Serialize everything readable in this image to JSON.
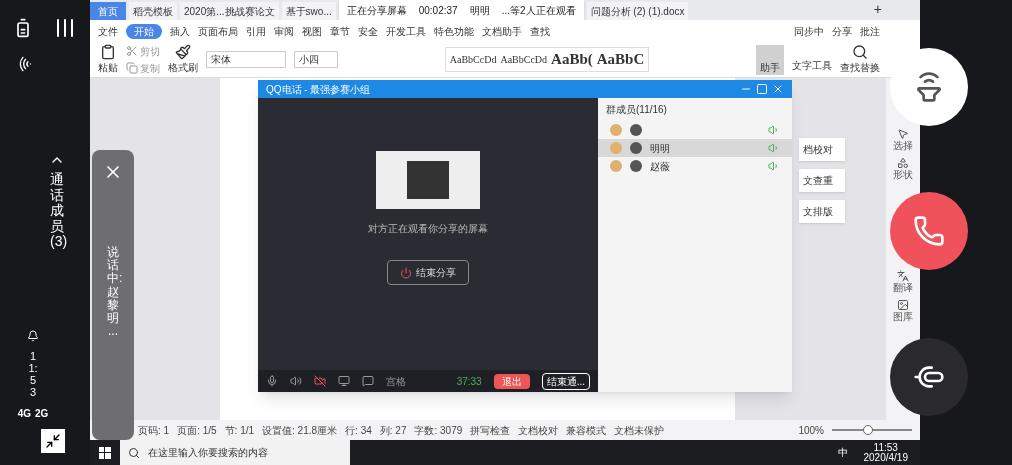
{
  "phone_left": {
    "network": "4G",
    "network_2": "2G",
    "time": "11:53",
    "members_label": "通话成员(3)"
  },
  "speaking_panel": {
    "text": "说话中:赵黎明 ..."
  },
  "tabs": [
    {
      "label": "首页",
      "selected": true
    },
    {
      "label": "稻壳模板",
      "selected": false
    },
    {
      "label": "2020第...挑战赛论文",
      "selected": false
    },
    {
      "label": "基于swo...",
      "selected": false
    },
    {
      "label": "问题分析 (2) (1).docx",
      "selected": false
    }
  ],
  "new_tab": "+",
  "share_banner": {
    "status": "正在分享屏幕",
    "duration": "00:02:37",
    "viewer": "明明",
    "viewers_note": "...等2人正在观看"
  },
  "menu": [
    {
      "label": "文件",
      "selected": false
    },
    {
      "label": "开始",
      "selected": true
    },
    {
      "label": "插入",
      "selected": false
    },
    {
      "label": "页面布局",
      "selected": false
    },
    {
      "label": "引用",
      "selected": false
    },
    {
      "label": "审阅",
      "selected": false
    },
    {
      "label": "视图",
      "selected": false
    },
    {
      "label": "章节",
      "selected": false
    },
    {
      "label": "安全",
      "selected": false
    },
    {
      "label": "开发工具",
      "selected": false
    },
    {
      "label": "特色功能",
      "selected": false
    },
    {
      "label": "文档助手",
      "selected": false
    },
    {
      "label": "查找",
      "selected": false
    }
  ],
  "menu_right": [
    "同步中",
    "分享",
    "批注"
  ],
  "toolbar": {
    "paste": "粘贴",
    "cut": "剪切",
    "copy": "复制",
    "format_painter": "格式刷",
    "font": "宋体",
    "size": "小四",
    "styles": [
      "AaBbCcDd",
      "AaBbCcDd",
      "AaBb(",
      "AaBbC"
    ],
    "assistant": "助手",
    "text_tools": "文字工具",
    "find_replace": "查找替换"
  },
  "qq_call": {
    "title": "QQ电话 - 最强参赛小组",
    "notice": "对方正在观看你分享的屏幕",
    "stop_share": "结束分享",
    "grid": "宫格",
    "timer": "37:33",
    "exit": "退出",
    "end_call": "结束通...",
    "members_title": "群成员(11/16)",
    "members": [
      {
        "selected": false
      },
      {
        "name": "明明",
        "selected": true
      },
      {
        "name": "赵薇",
        "selected": false
      }
    ]
  },
  "side_buttons": [
    "档校对",
    "文查重",
    "文排版"
  ],
  "right_tools": [
    "选择",
    "形状",
    "翻译",
    "图库"
  ],
  "status_bar": [
    "页码: 1",
    "页面: 1/5",
    "节: 1/1",
    "设置值: 21.8厘米",
    "行: 34",
    "列: 27",
    "字数: 3079",
    "拼写检查",
    "文档校对",
    "兼容模式",
    "文档未保护"
  ],
  "zoom": "100%",
  "zoom_slider": {
    "level": 0.45
  },
  "taskbar": {
    "search_placeholder": "在这里输入你要搜索的内容",
    "ime": "中",
    "time": "11:53",
    "date": "2020/4/19"
  }
}
